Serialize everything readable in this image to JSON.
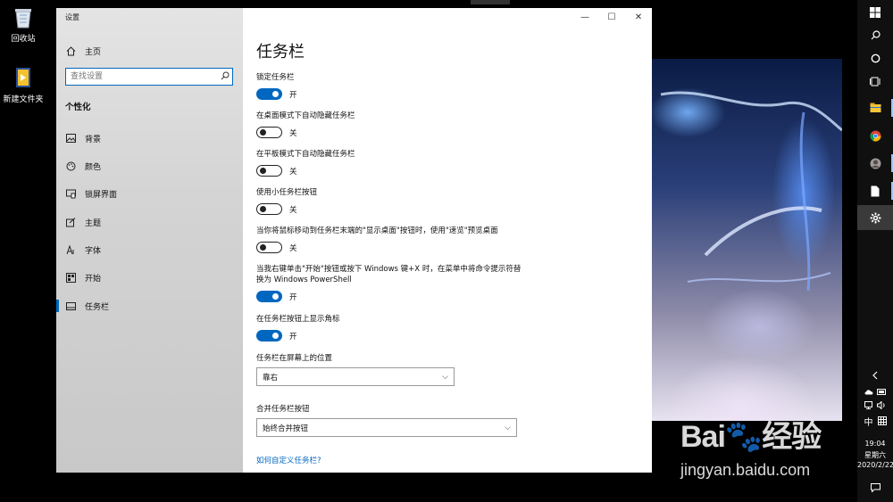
{
  "desktop": {
    "icons": [
      {
        "label": "回收站",
        "icon": "recycle-bin-icon"
      },
      {
        "label": "新建文件夹",
        "icon": "folder-icon"
      }
    ]
  },
  "window": {
    "app_title": "设置",
    "controls": {
      "minimize": "—",
      "maximize": "☐",
      "close": "✕"
    }
  },
  "sidebar": {
    "home_label": "主页",
    "search_placeholder": "查找设置",
    "section_title": "个性化",
    "items": [
      {
        "label": "背景",
        "icon": "image-icon"
      },
      {
        "label": "颜色",
        "icon": "palette-icon"
      },
      {
        "label": "锁屏界面",
        "icon": "lock-screen-icon"
      },
      {
        "label": "主题",
        "icon": "theme-icon"
      },
      {
        "label": "字体",
        "icon": "font-icon"
      },
      {
        "label": "开始",
        "icon": "start-icon"
      },
      {
        "label": "任务栏",
        "icon": "taskbar-icon"
      }
    ],
    "selected": "任务栏"
  },
  "content": {
    "page_title": "任务栏",
    "settings": [
      {
        "label": "锁定任务栏",
        "state": "开",
        "on": true
      },
      {
        "label": "在桌面模式下自动隐藏任务栏",
        "state": "关",
        "on": false
      },
      {
        "label": "在平板模式下自动隐藏任务栏",
        "state": "关",
        "on": false
      },
      {
        "label": "使用小任务栏按钮",
        "state": "关",
        "on": false
      },
      {
        "label": "当你将鼠标移动到任务栏末端的\"显示桌面\"按钮时，使用\"速览\"预览桌面",
        "state": "关",
        "on": false
      },
      {
        "label": "当我右键单击\"开始\"按钮或按下 Windows 键+X 时，在菜单中将命令提示符替换为 Windows PowerShell",
        "state": "开",
        "on": true
      },
      {
        "label": "在任务栏按钮上显示角标",
        "state": "开",
        "on": true
      }
    ],
    "position": {
      "label": "任务栏在屏幕上的位置",
      "value": "靠右"
    },
    "combine": {
      "label": "合并任务栏按钮",
      "value": "始终合并按钮"
    },
    "help_link": "如何自定义任务栏?"
  },
  "taskbar": {
    "tray": {
      "ime": "中",
      "time": "19:04",
      "weekday": "星期六",
      "date": "2020/2/22"
    }
  },
  "watermark": {
    "logo": "Bai🐾经验",
    "url": "jingyan.baidu.com"
  }
}
